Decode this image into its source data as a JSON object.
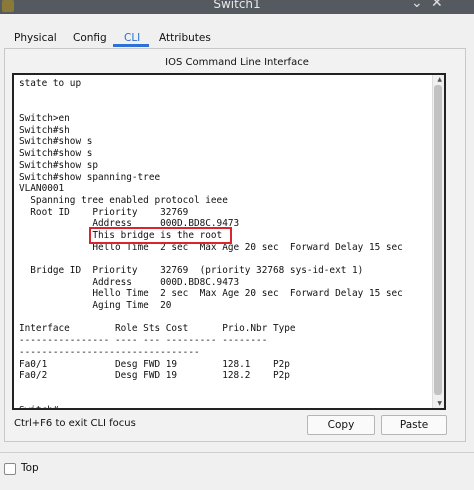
{
  "window": {
    "title": "Switch1",
    "minimize_glyph": "⌄",
    "close_glyph": "✕"
  },
  "tabs": [
    {
      "label": "Physical"
    },
    {
      "label": "Config"
    },
    {
      "label": "CLI"
    },
    {
      "label": "Attributes"
    }
  ],
  "active_tab": "CLI",
  "panel": {
    "title": "IOS Command Line Interface"
  },
  "terminal": {
    "lines": [
      "state to up",
      "",
      "",
      "Switch>en",
      "Switch#sh",
      "Switch#show s",
      "Switch#show s",
      "Switch#show sp",
      "Switch#show spanning-tree",
      "VLAN0001",
      "  Spanning tree enabled protocol ieee",
      "  Root ID    Priority    32769",
      "             Address     000D.BD8C.9473",
      "             This bridge is the root",
      "             Hello Time  2 sec  Max Age 20 sec  Forward Delay 15 sec",
      "",
      "  Bridge ID  Priority    32769  (priority 32768 sys-id-ext 1)",
      "             Address     000D.BD8C.9473",
      "             Hello Time  2 sec  Max Age 20 sec  Forward Delay 15 sec",
      "             Aging Time  20",
      "",
      "Interface        Role Sts Cost      Prio.Nbr Type",
      "---------------- ---- --- --------- --------",
      "--------------------------------",
      "Fa0/1            Desg FWD 19        128.1    P2p",
      "Fa0/2            Desg FWD 19        128.2    P2p",
      "",
      "",
      "Switch#"
    ],
    "highlight_color": "#d9262c"
  },
  "footer": {
    "hint": "Ctrl+F6 to exit CLI focus",
    "copy_label": "Copy",
    "paste_label": "Paste"
  },
  "top_checkbox": {
    "label": "Top",
    "checked": false
  }
}
